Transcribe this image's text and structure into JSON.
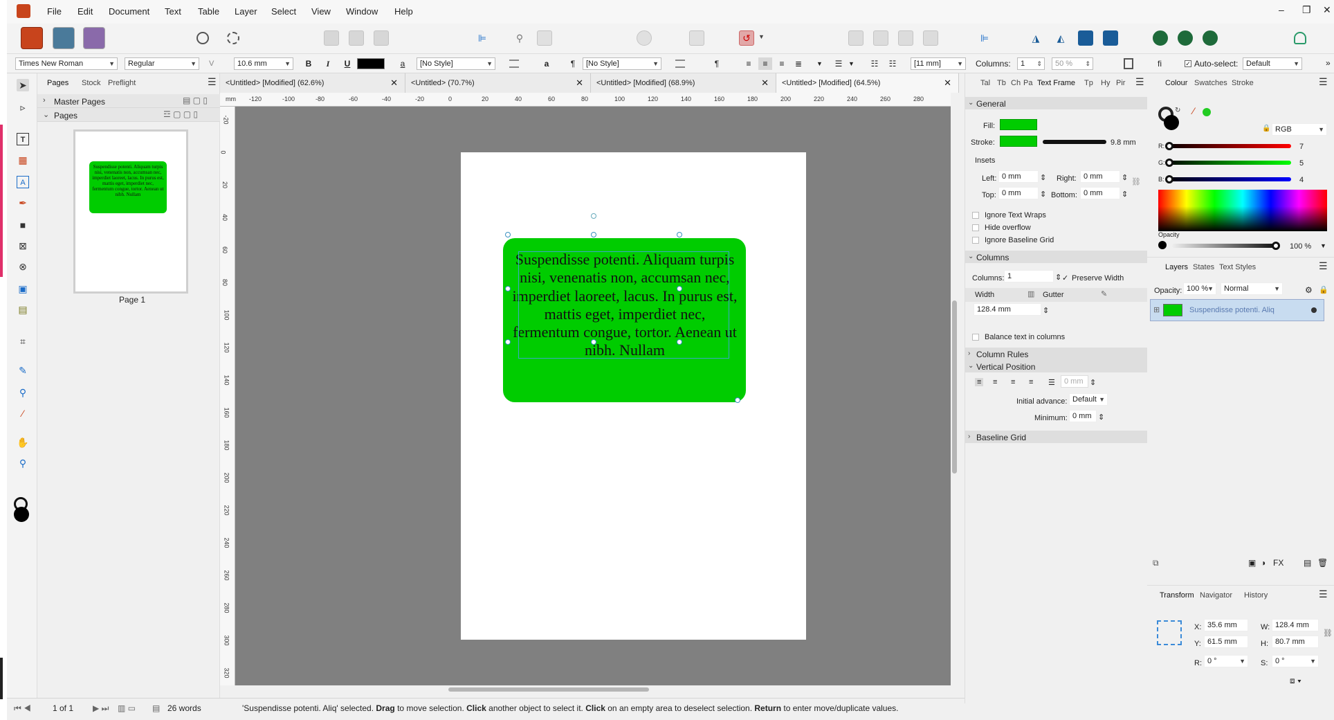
{
  "menu": {
    "items": [
      "File",
      "Edit",
      "Document",
      "Text",
      "Table",
      "Layer",
      "Select",
      "View",
      "Window",
      "Help"
    ]
  },
  "window_controls": [
    "–",
    "❐",
    "✕"
  ],
  "context": {
    "font": "Times New Roman",
    "style": "Regular",
    "size": "10.6 mm",
    "bold": "B",
    "italic": "I",
    "underline": "U",
    "char_icon": "a",
    "pilcrow": "¶",
    "para_style": "[No Style]",
    "char_style": "[No Style]",
    "leading": "[11 mm]",
    "columns_label": "Columns:",
    "columns_value": "1",
    "percent": "50 %",
    "ligature": "fi",
    "autoselect_label": "Auto-select:",
    "autoselect_value": "Default",
    "more": "»"
  },
  "pages_panel": {
    "tabs": [
      "Pages",
      "Stock",
      "Preflight"
    ],
    "master_pages": "Master Pages",
    "pages": "Pages",
    "page_label": "Page 1"
  },
  "doc_tabs": [
    "<Untitled> [Modified] (62.6%)",
    "<Untitled> (70.7%)",
    "<Untitled> [Modified] (68.9%)",
    "<Untitled> [Modified] (64.5%)"
  ],
  "ruler": {
    "unit": "mm",
    "h": [
      "-120",
      "-100",
      "-80",
      "-60",
      "-40",
      "-20",
      "0",
      "20",
      "40",
      "60",
      "80",
      "100",
      "120",
      "140",
      "160",
      "180",
      "200",
      "220",
      "240",
      "260",
      "280"
    ],
    "v": [
      "-20",
      "0",
      "20",
      "40",
      "60",
      "80",
      "100",
      "120",
      "140",
      "160",
      "180",
      "200",
      "220",
      "240",
      "260",
      "280",
      "300",
      "320"
    ]
  },
  "frame": {
    "text": "Suspendisse potenti. Aliquam turpis nisi, venenatis non, accumsan nec, imperdiet laoreet, lacus. In purus est, mattis eget, imperdiet nec, fermentum congue, tortor. Aenean ut nibh. Nullam",
    "fill": "#00cc00"
  },
  "status": {
    "page": "1 of 1",
    "words": "26 words",
    "sel": "'Suspendisse potenti. Aliq'",
    "msg1": " selected. ",
    "drag": "Drag",
    "msg2": " to move selection. ",
    "click1": "Click",
    "msg3": " another object to select it. ",
    "click2": "Click",
    "msg4": " on an empty area to deselect selection. ",
    "ret": "Return",
    "msg5": " to enter move/duplicate values."
  },
  "text_frame_panel": {
    "tabs": [
      "Tal",
      "Tb",
      "Ch",
      "Pa",
      "Text Frame",
      "Tp",
      "Hy",
      "Pir"
    ],
    "general": "General",
    "fill": "Fill:",
    "stroke": "Stroke:",
    "stroke_width": "9.8 mm",
    "insets": "Insets",
    "left": "Left:",
    "left_v": "0 mm",
    "right": "Right:",
    "right_v": "0 mm",
    "top": "Top:",
    "top_v": "0 mm",
    "bottom": "Bottom:",
    "bottom_v": "0 mm",
    "ignore_wraps": "Ignore Text Wraps",
    "hide_overflow": "Hide overflow",
    "ignore_grid": "Ignore Baseline Grid",
    "columns_sec": "Columns",
    "columns_lbl": "Columns:",
    "columns_v": "1",
    "preserve": "Preserve Width",
    "width": "Width",
    "gutter": "Gutter",
    "width_v": "128.4 mm",
    "balance": "Balance text in columns",
    "col_rules": "Column Rules",
    "vert_pos": "Vertical Position",
    "vp_field": "0 mm",
    "initial_adv": "Initial advance:",
    "initial_v": "Default",
    "minimum": "Minimum:",
    "minimum_v": "0 mm",
    "baseline": "Baseline Grid"
  },
  "colour_panel": {
    "tabs": [
      "Colour",
      "Swatches",
      "Stroke"
    ],
    "model": "RGB",
    "r_lbl": "R:",
    "r": "7",
    "g_lbl": "G:",
    "g": "5",
    "b_lbl": "B:",
    "b": "4",
    "opacity": "Opacity",
    "opacity_v": "100 %"
  },
  "layers_panel": {
    "tabs": [
      "Layers",
      "States",
      "Text Styles"
    ],
    "opacity_lbl": "Opacity:",
    "opacity_v": "100 %",
    "blend": "Normal",
    "layer_name": "Suspendisse potenti. Aliq",
    "fx": "FX"
  },
  "transform_panel": {
    "tabs": [
      "Transform",
      "Navigator",
      "History"
    ],
    "x_lbl": "X:",
    "x": "35.6 mm",
    "w_lbl": "W:",
    "w": "128.4 mm",
    "y_lbl": "Y:",
    "y": "61.5 mm",
    "h_lbl": "H:",
    "h": "80.7 mm",
    "r_lbl": "R:",
    "r": "0 °",
    "s_lbl": "S:",
    "s": "0 °"
  }
}
